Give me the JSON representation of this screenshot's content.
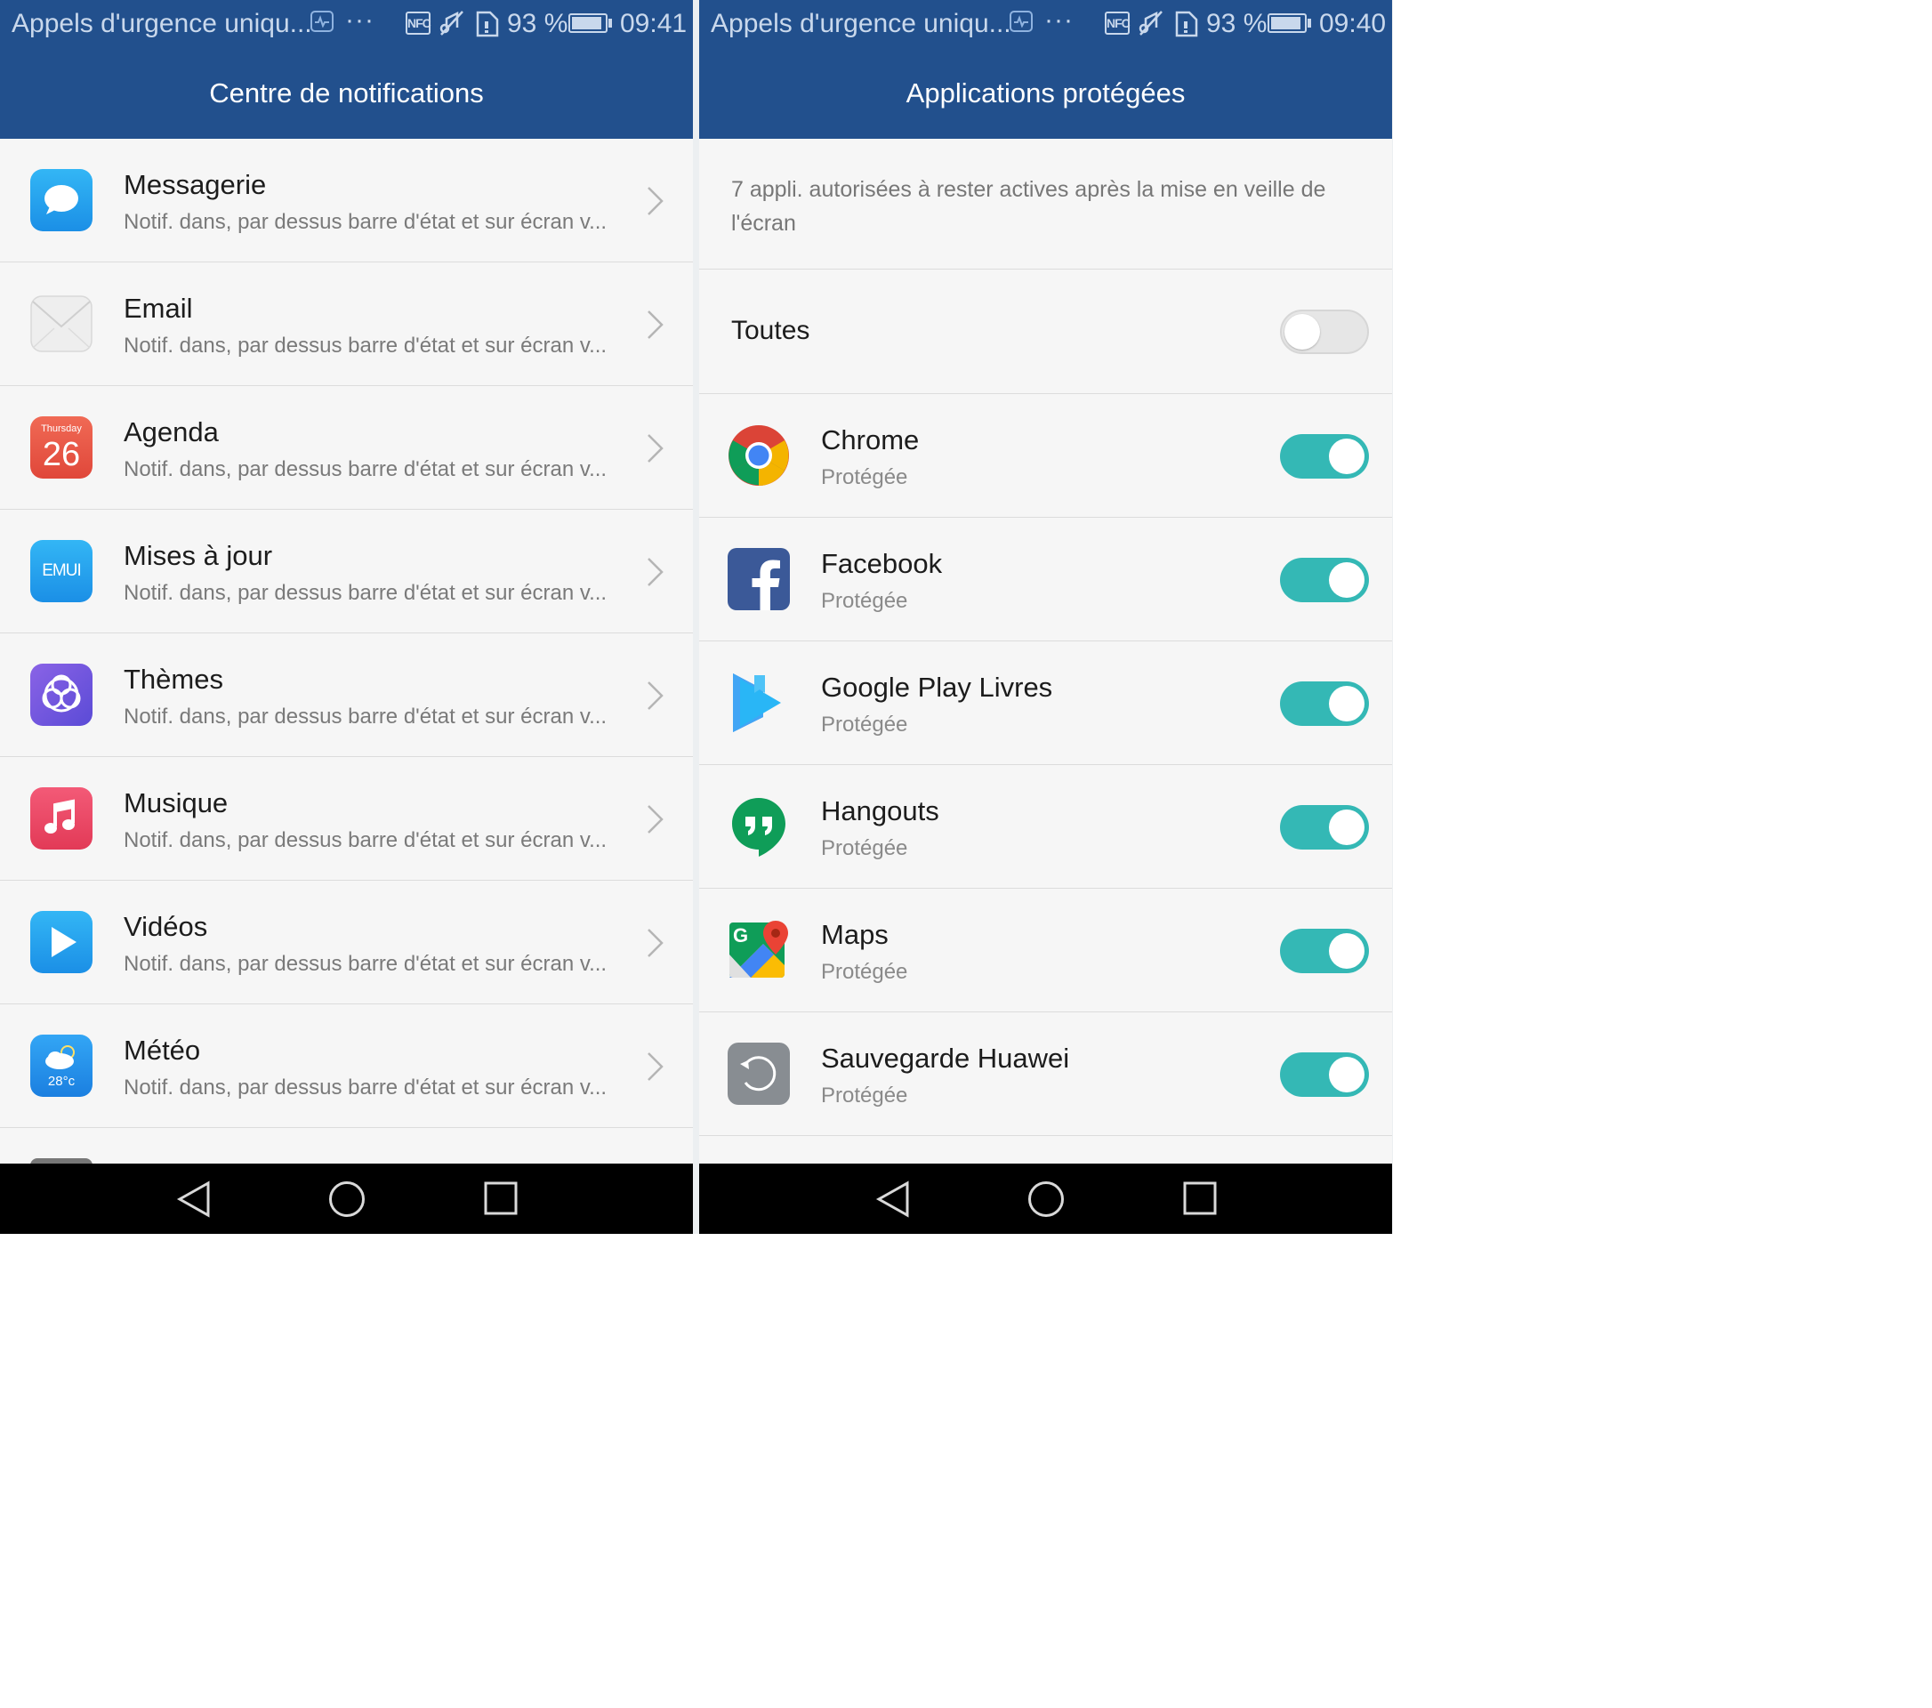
{
  "left_screen": {
    "status_bar": {
      "carrier": "Appels d'urgence uniqu...",
      "battery_percent": "93 %",
      "battery_level": 0.93,
      "time": "09:41",
      "nfc_label": "NFC"
    },
    "title": "Centre de notifications",
    "items": [
      {
        "title": "Messagerie",
        "subtitle": "Notif. dans, par dessus barre d'état et sur écran v...",
        "icon": "messaging-icon"
      },
      {
        "title": "Email",
        "subtitle": "Notif. dans, par dessus barre d'état et sur écran v...",
        "icon": "email-icon"
      },
      {
        "title": "Agenda",
        "subtitle": "Notif. dans, par dessus barre d'état et sur écran v...",
        "icon": "calendar-icon",
        "icon_day": "Thursday",
        "icon_date": "26"
      },
      {
        "title": "Mises à jour",
        "subtitle": "Notif. dans, par dessus barre d'état et sur écran v...",
        "icon": "emui-update-icon",
        "icon_text": "EMUI"
      },
      {
        "title": "Thèmes",
        "subtitle": "Notif. dans, par dessus barre d'état et sur écran v...",
        "icon": "themes-icon"
      },
      {
        "title": "Musique",
        "subtitle": "Notif. dans, par dessus barre d'état et sur écran v...",
        "icon": "music-icon"
      },
      {
        "title": "Vidéos",
        "subtitle": "Notif. dans, par dessus barre d'état et sur écran v...",
        "icon": "video-icon"
      },
      {
        "title": "Météo",
        "subtitle": "Notif. dans, par dessus barre d'état et sur écran v...",
        "icon": "weather-icon",
        "icon_temp": "28°c"
      }
    ]
  },
  "right_screen": {
    "status_bar": {
      "carrier": "Appels d'urgence uniqu...",
      "battery_percent": "93 %",
      "battery_level": 0.93,
      "time": "09:40",
      "nfc_label": "NFC"
    },
    "title": "Applications protégées",
    "description": "7 appli. autorisées à rester actives après la mise en veille de l'écran",
    "all_toggle": {
      "label": "Toutes",
      "on": false
    },
    "apps": [
      {
        "name": "Chrome",
        "status": "Protégée",
        "on": true,
        "icon": "chrome-icon"
      },
      {
        "name": "Facebook",
        "status": "Protégée",
        "on": true,
        "icon": "facebook-icon"
      },
      {
        "name": "Google Play Livres",
        "status": "Protégée",
        "on": true,
        "icon": "play-books-icon"
      },
      {
        "name": "Hangouts",
        "status": "Protégée",
        "on": true,
        "icon": "hangouts-icon"
      },
      {
        "name": "Maps",
        "status": "Protégée",
        "on": true,
        "icon": "maps-icon",
        "icon_letter": "G"
      },
      {
        "name": "Sauvegarde Huawei",
        "status": "Protégée",
        "on": true,
        "icon": "huawei-backup-icon"
      }
    ]
  },
  "colors": {
    "header": "#22508d",
    "toggle_on": "#34b8b5",
    "toggle_off": "#e6e6e6",
    "nav_bar": "#000000"
  }
}
